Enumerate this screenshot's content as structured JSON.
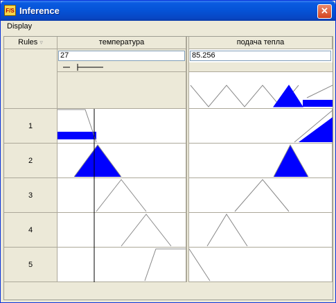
{
  "window": {
    "title": "Inference",
    "close_glyph": "✕",
    "app_icon": "fis-logo-icon"
  },
  "menu": {
    "items": [
      "Display"
    ]
  },
  "table": {
    "rules_header": "Rules",
    "inputs": [
      {
        "name": "температура",
        "value": "27"
      }
    ],
    "outputs": [
      {
        "name": "подача тепла",
        "value": "85.256"
      }
    ],
    "rows": [
      "1",
      "2",
      "3",
      "4",
      "5"
    ]
  },
  "colors": {
    "fill": "#0000FF",
    "line": "#000000",
    "grid": "#ACA899"
  }
}
